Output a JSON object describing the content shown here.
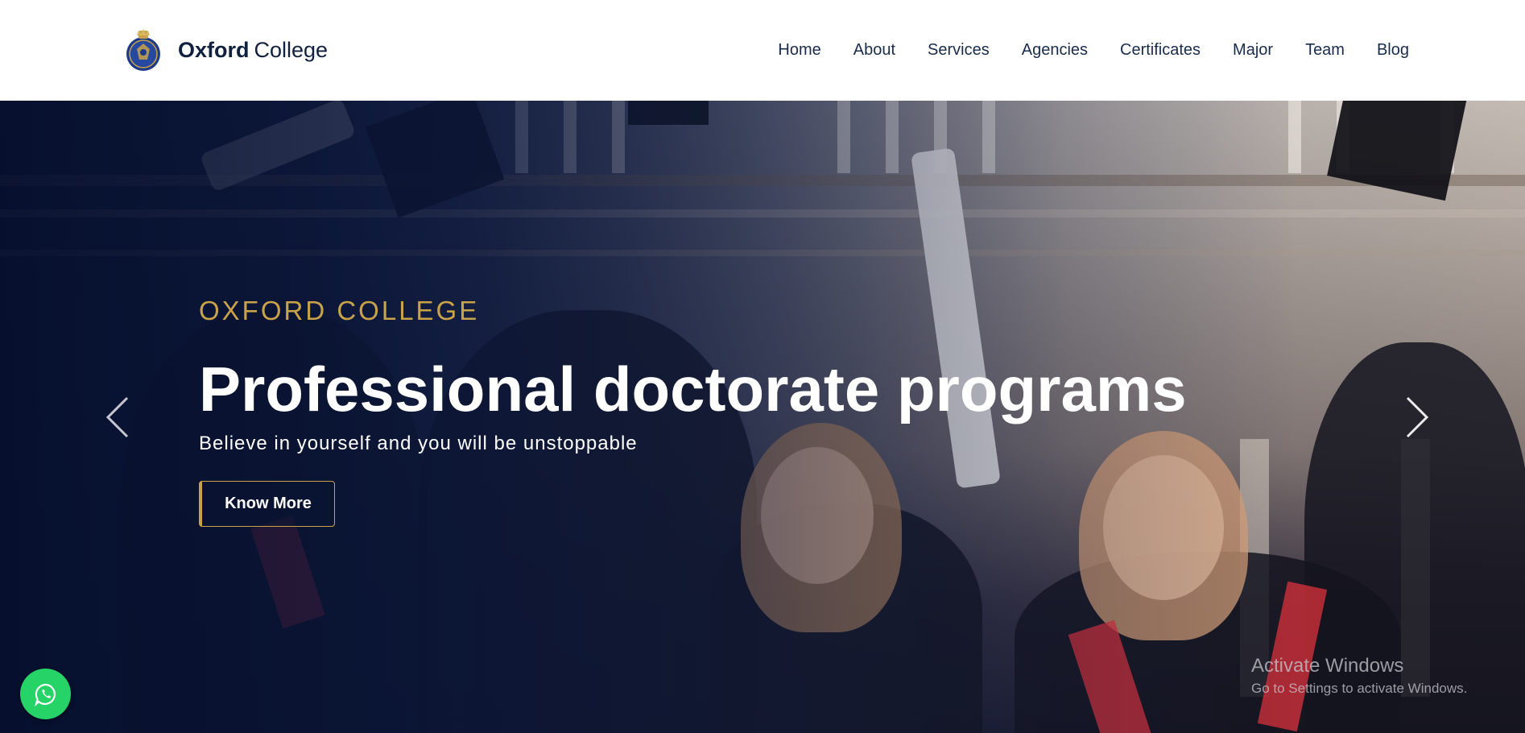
{
  "brand": {
    "name_bold": "Oxford",
    "name_light": "College"
  },
  "nav": {
    "items": [
      "Home",
      "About",
      "Services",
      "Agencies",
      "Certificates",
      "Major",
      "Team",
      "Blog"
    ]
  },
  "hero": {
    "eyebrow": "OXFORD COLLEGE",
    "headline": "Professional doctorate programs",
    "subline": "Believe in yourself and you will be unstoppable",
    "cta_label": "Know More"
  },
  "carousel": {
    "prev_icon": "chevron-left-icon",
    "next_icon": "chevron-right-icon"
  },
  "floating": {
    "whatsapp_icon": "whatsapp-icon"
  },
  "watermark": {
    "title": "Activate Windows",
    "subtitle": "Go to Settings to activate Windows."
  },
  "colors": {
    "accent_gold": "#c9a34a",
    "navy": "#10213f",
    "whatsapp_green": "#25d366"
  }
}
